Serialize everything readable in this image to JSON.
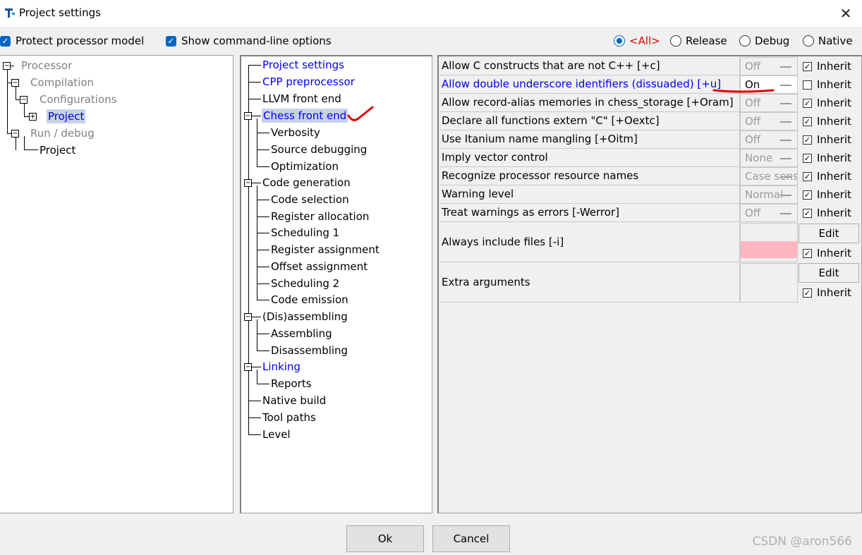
{
  "window": {
    "title": "Project settings",
    "close_glyph": "✕"
  },
  "options": {
    "protect_label": "Protect processor model",
    "show_cmd_label": "Show command-line options",
    "radios": [
      "<All>",
      "Release",
      "Debug",
      "Native"
    ],
    "selected_radio": "<All>"
  },
  "left_tree": [
    "Processor",
    "Compilation",
    "Configurations",
    "Project",
    "Run / debug",
    "Project"
  ],
  "mid_tree": [
    "Project settings",
    "CPP preprocessor",
    "LLVM front end",
    "Chess front end",
    "Verbosity",
    "Source debugging",
    "Optimization",
    "Code generation",
    "Code selection",
    "Register allocation",
    "Scheduling 1",
    "Register assignment",
    "Offset assignment",
    "Scheduling 2",
    "Code emission",
    "(Dis)assembling",
    "Assembling",
    "Disassembling",
    "Linking",
    "Reports",
    "Native build",
    "Tool paths",
    "Level"
  ],
  "properties": [
    {
      "label": "Allow C constructs that are not C++  [+c]",
      "value": "Off",
      "inherit": true
    },
    {
      "label": "Allow double underscore identifiers (dissuaded)  [+u]",
      "value": "On",
      "inherit": false
    },
    {
      "label": "Allow record-alias memories in chess_storage  [+Oram]",
      "value": "Off",
      "inherit": true
    },
    {
      "label": "Declare all functions extern \"C\"  [+Oextc]",
      "value": "Off",
      "inherit": true
    },
    {
      "label": "Use Itanium name mangling  [+Oitm]",
      "value": "Off",
      "inherit": true
    },
    {
      "label": "Imply vector control",
      "value": "None",
      "inherit": true
    },
    {
      "label": "Recognize processor resource names",
      "value": "Case sens",
      "inherit": true
    },
    {
      "label": "Warning level",
      "value": "Normal",
      "inherit": true
    },
    {
      "label": "Treat warnings as errors  [-Werror]",
      "value": "Off",
      "inherit": true
    }
  ],
  "list_props": [
    {
      "label": "Always include files  [-i]",
      "edit": "Edit",
      "inherit_label": "Inherit"
    },
    {
      "label": "Extra arguments",
      "edit": "Edit",
      "inherit_label": "Inherit"
    }
  ],
  "inherit_label": "Inherit",
  "buttons": {
    "ok": "Ok",
    "cancel": "Cancel"
  },
  "watermark": "CSDN @aron566",
  "colors": {
    "accent": "#0067c0",
    "link_blue": "#0000ee",
    "all_red": "#e00000",
    "annotation_red": "#e00000",
    "pink": "#ffb6c1"
  }
}
